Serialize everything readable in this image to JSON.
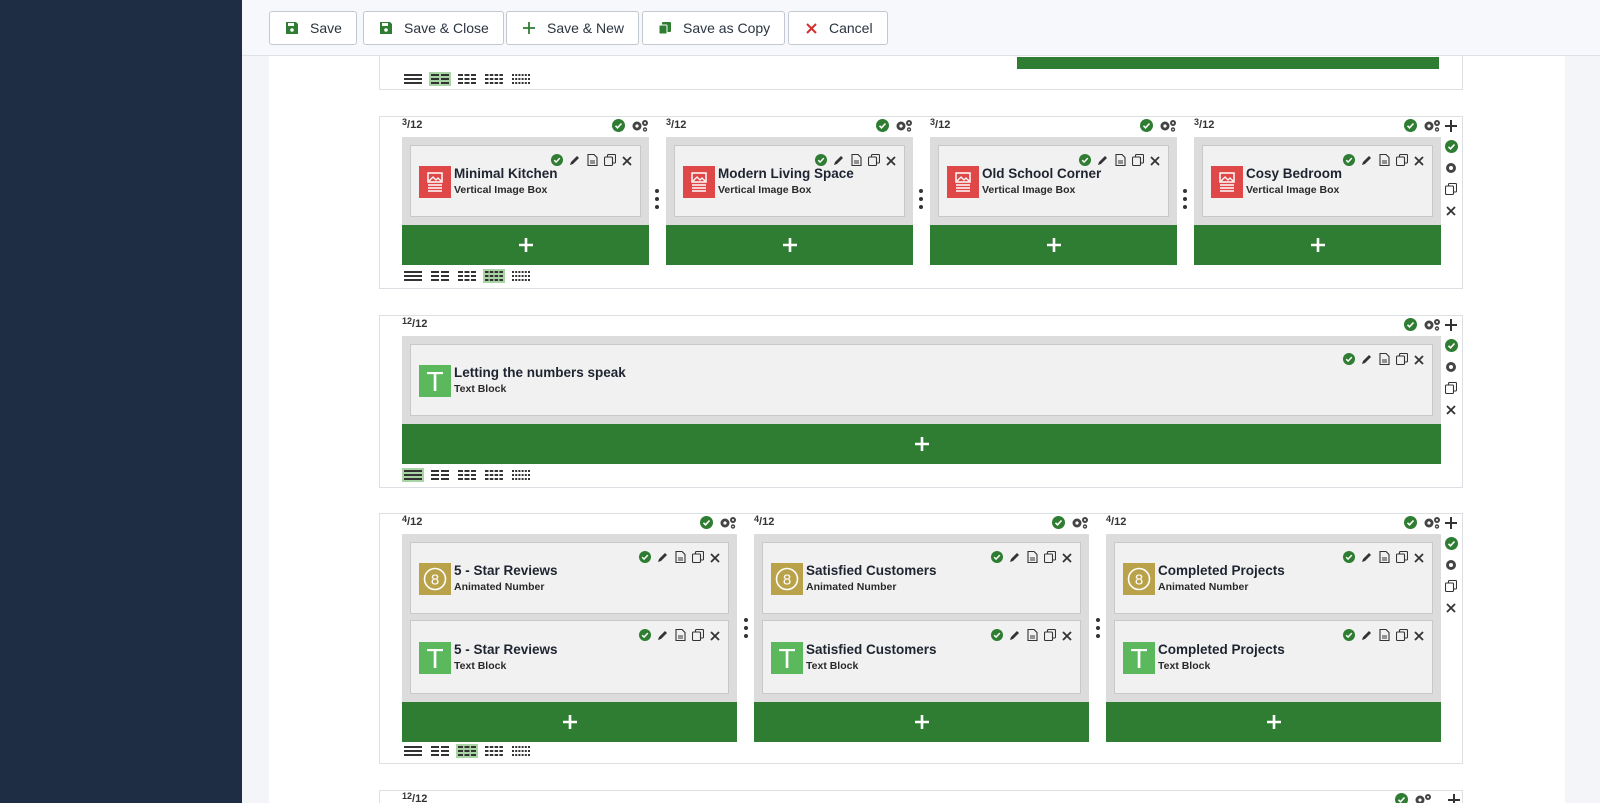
{
  "toolbar": {
    "save": "Save",
    "save_close": "Save & Close",
    "save_new": "Save & New",
    "save_copy": "Save as Copy",
    "cancel": "Cancel"
  },
  "rows": [
    {
      "fraction_num": "3",
      "fraction_den": "12",
      "columns": [
        {
          "title": "Minimal Kitchen",
          "subtitle": "Vertical Image Box"
        },
        {
          "title": "Modern Living Space",
          "subtitle": "Vertical Image Box"
        },
        {
          "title": "Old School Corner",
          "subtitle": "Vertical Image Box"
        },
        {
          "title": "Cosy Bedroom",
          "subtitle": "Vertical Image Box"
        }
      ]
    },
    {
      "fraction_num": "12",
      "fraction_den": "12",
      "columns": [
        {
          "title": "Letting the numbers speak",
          "subtitle": "Text Block"
        }
      ]
    },
    {
      "fraction_num": "4",
      "fraction_den": "12",
      "columns": [
        {
          "items": [
            {
              "title": "5 - Star Reviews",
              "subtitle": "Animated Number"
            },
            {
              "title": "5 - Star Reviews",
              "subtitle": "Text Block"
            }
          ]
        },
        {
          "items": [
            {
              "title": "Satisfied Customers",
              "subtitle": "Animated Number"
            },
            {
              "title": "Satisfied Customers",
              "subtitle": "Text Block"
            }
          ]
        },
        {
          "items": [
            {
              "title": "Completed Projects",
              "subtitle": "Animated Number"
            },
            {
              "title": "Completed Projects",
              "subtitle": "Text Block"
            }
          ]
        }
      ]
    },
    {
      "fraction_num": "12",
      "fraction_den": "12"
    }
  ],
  "icons": {
    "image_box": "vertical-image-box-icon",
    "text_block": "T",
    "animated_number": "8"
  },
  "colors": {
    "sidebar": "#1f2d44",
    "green": "#2e7d32",
    "check": "#2e7d32",
    "image_icon": "#e04848",
    "text_icon": "#5cb85c",
    "number_icon": "#b9a24a",
    "cancel_red": "#d32f2f"
  }
}
